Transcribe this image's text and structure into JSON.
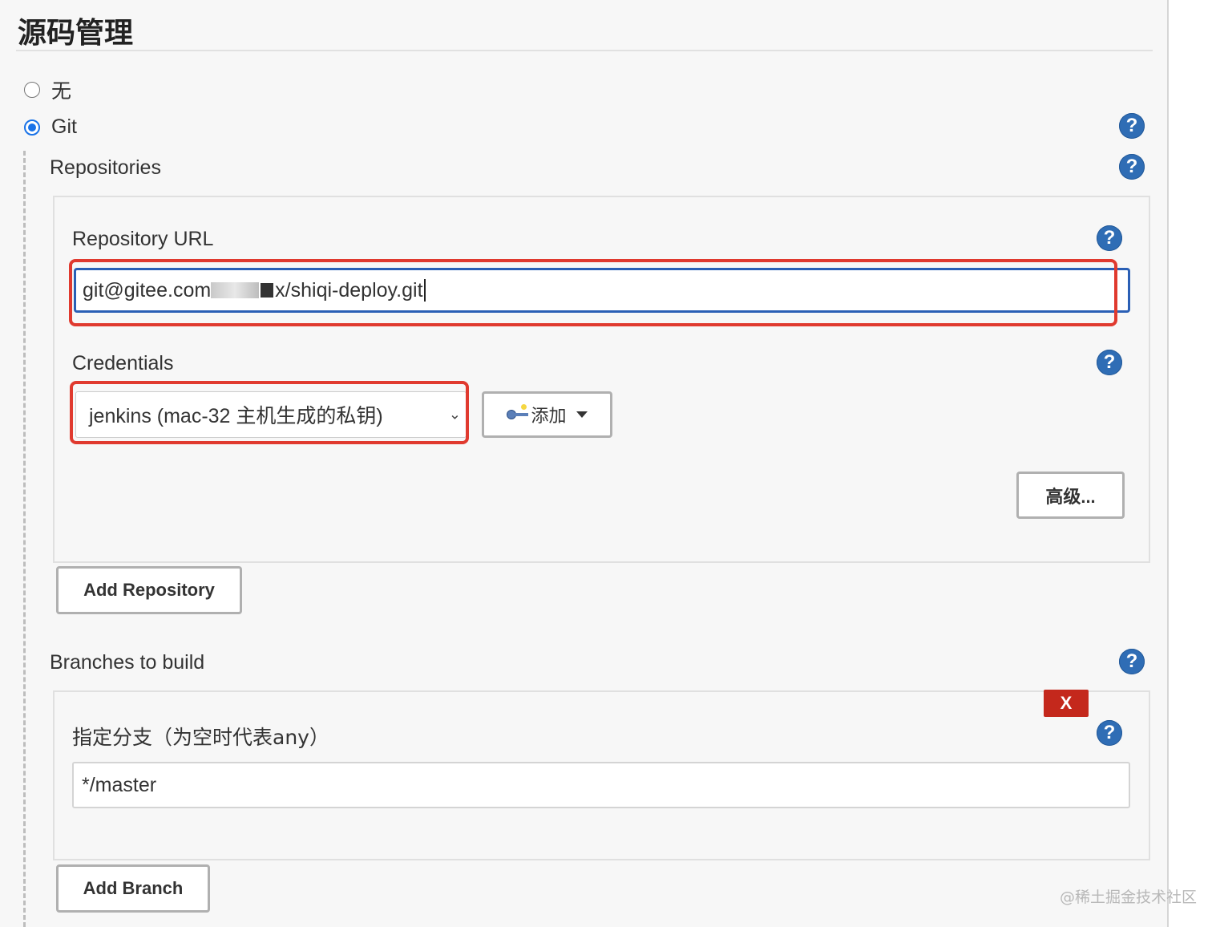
{
  "section": {
    "title": "源码管理"
  },
  "scm_options": [
    {
      "label": "无",
      "selected": false
    },
    {
      "label": "Git",
      "selected": true
    }
  ],
  "help_icon_glyph": "?",
  "repositories": {
    "label": "Repositories",
    "repository_url": {
      "label": "Repository URL",
      "value_prefix": "git@gitee.com",
      "value_suffix": "x/shiqi-deploy.git",
      "partially_redacted": true
    },
    "credentials": {
      "label": "Credentials",
      "selected": "jenkins (mac-32 主机生成的私钥)",
      "add_button": "添加"
    },
    "advanced_button": "高级...",
    "add_repository_button": "Add Repository"
  },
  "branches": {
    "label": "Branches to build",
    "delete_button": "X",
    "specifier_label": "指定分支（为空时代表any）",
    "specifier_value": "*/master",
    "add_branch_button": "Add Branch"
  },
  "watermark": "@稀土掘金技术社区",
  "colors": {
    "accent_blue": "#2f6db5",
    "highlight_red": "#e03a2f",
    "delete_red": "#c4281c",
    "panel_bg": "#f7f7f7"
  }
}
